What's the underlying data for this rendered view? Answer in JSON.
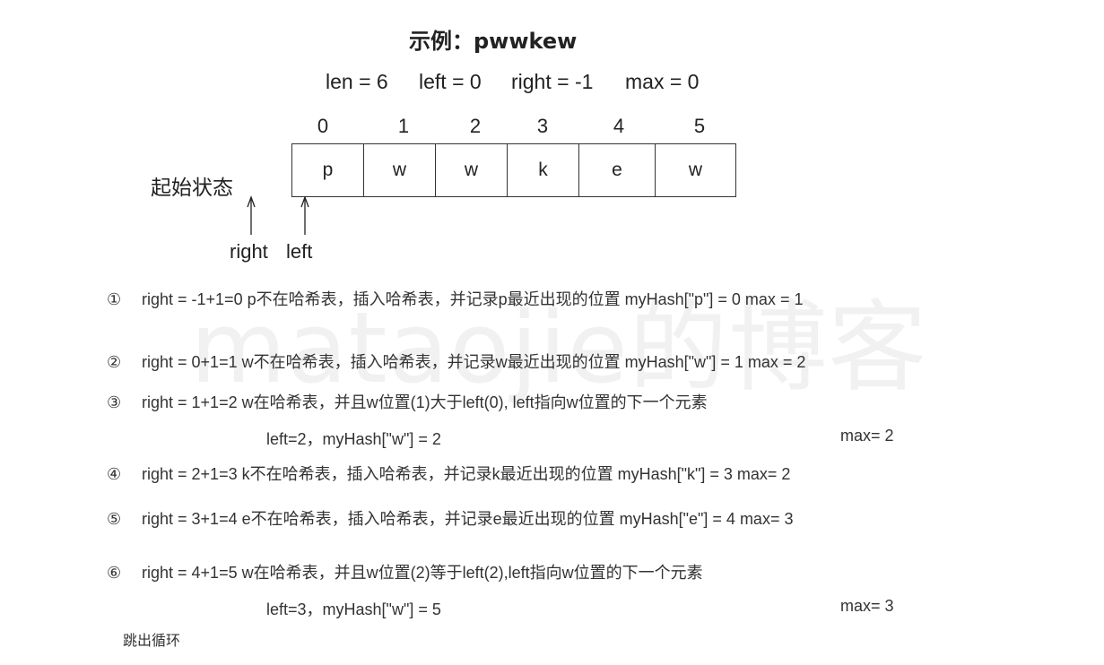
{
  "title": "示例：pwwkew",
  "params": {
    "len": "len = 6",
    "left": "left = 0",
    "right": "right = -1",
    "max": "max = 0"
  },
  "indices": [
    "0",
    "1",
    "2",
    "3",
    "4",
    "5"
  ],
  "cells": [
    "p",
    "w",
    "w",
    "k",
    "e",
    "w"
  ],
  "start_label": "起始状态",
  "pointers": {
    "right": "right",
    "left": "left"
  },
  "watermark": "mataojie的博客",
  "steps": [
    {
      "num": "①",
      "text": "right = -1+1=0  p不在哈希表，插入哈希表，并记录p最近出现的位置   myHash[\"p\"] = 0   max = 1"
    },
    {
      "num": "②",
      "text": "right =  0+1=1  w不在哈希表，插入哈希表，并记录w最近出现的位置  myHash[\"w\"] = 1   max = 2"
    },
    {
      "num": "③",
      "text": "right =  1+1=2 w在哈希表，并且w位置(1)大于left(0), left指向w位置的下一个元素",
      "sub": "left=2，myHash[\"w\"] = 2",
      "max": "max= 2"
    },
    {
      "num": "④",
      "text": "right =  2+1=3  k不在哈希表，插入哈希表，并记录k最近出现的位置   myHash[\"k\"] = 3    max= 2"
    },
    {
      "num": "⑤",
      "text": "right =  3+1=4  e不在哈希表，插入哈希表，并记录e最近出现的位置   myHash[\"e\"] = 4    max= 3"
    },
    {
      "num": "⑥",
      "text": "right =  4+1=5  w在哈希表，并且w位置(2)等于left(2),left指向w位置的下一个元素",
      "sub": "left=3，myHash[\"w\"] = 5",
      "max": "max= 3"
    }
  ],
  "exit_text": "跳出循环"
}
